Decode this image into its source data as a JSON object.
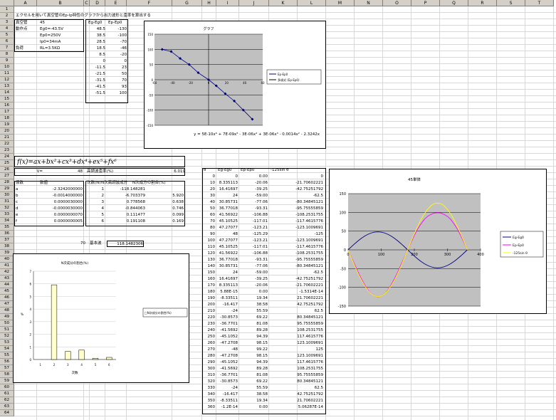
{
  "title_row": "エクセルを用いて真空管のEp-Ip特性のグラフから出力波形と歪率を算出する",
  "columns": [
    "A",
    "B",
    "C",
    "D",
    "E",
    "F",
    "G",
    "H",
    "I",
    "J",
    "K",
    "L",
    "M",
    "N",
    "O",
    "P",
    "Q",
    "R",
    "S",
    "T"
  ],
  "params": [
    {
      "label": "真空管",
      "value": "45"
    },
    {
      "label": "動作点",
      "value": "Eg0=-43.5V"
    },
    {
      "label": "",
      "value": "Ep0=250V"
    },
    {
      "label": "",
      "value": "Ip0=34mA"
    },
    {
      "label": "負荷",
      "value": "RL=3.5KΩ"
    }
  ],
  "egep": {
    "headers": [
      "Eg-Eg0",
      "Ep-Ep0"
    ],
    "rows": [
      [
        "48.5",
        "-130"
      ],
      [
        "38.5",
        "-100"
      ],
      [
        "28.5",
        "-70"
      ],
      [
        "18.5",
        "-46"
      ],
      [
        "8.5",
        "-20"
      ],
      [
        "0",
        "0"
      ],
      [
        "-11.5",
        "23"
      ],
      [
        "-21.5",
        "50"
      ],
      [
        "-31.5",
        "70"
      ],
      [
        "-41.5",
        "93"
      ],
      [
        "-51.5",
        "100"
      ]
    ]
  },
  "formula": "f(x)=ax+bx²+cx³+dx⁴+ex⁵+fx⁶",
  "v_label": "V=",
  "v_value": "48",
  "distortion_label": "高調波歪率(%)",
  "distortion_value": "6.019",
  "coef": {
    "headers": [
      "係数",
      "数値"
    ],
    "rows": [
      [
        "a",
        "-2.3242000000"
      ],
      [
        "b",
        "-0.0014000000"
      ],
      [
        "c",
        "0.0000030000"
      ],
      [
        "d",
        "-0.0000030000"
      ],
      [
        "e",
        "0.0000000070"
      ],
      [
        "f",
        "0.0000000005"
      ]
    ]
  },
  "harm": {
    "headers": [
      "次数(N)",
      "N次高調波成分",
      "N次成分の割合(%)"
    ],
    "rows": [
      [
        "1",
        "-118.148281",
        ""
      ],
      [
        "2",
        "-6.703379",
        "5.920"
      ],
      [
        "3",
        "0.778568",
        "0.638"
      ],
      [
        "4",
        "-0.844063",
        "0.746"
      ],
      [
        "5",
        "0.111477",
        "0.099"
      ],
      [
        "6",
        "0.191108",
        "0.169"
      ]
    ]
  },
  "fund": {
    "label": "70",
    "name": "基本波",
    "value": "118.1482306"
  },
  "table": {
    "headers": [
      "θ",
      "Eg-Eg0",
      "Ep-Ep0",
      "-125sin θ"
    ],
    "rows": [
      [
        "0",
        "0",
        "0.00",
        "0"
      ],
      [
        "10",
        "8.335113",
        "-20.06",
        "-21.70602221"
      ],
      [
        "20",
        "16.41697",
        "-39.25",
        "-42.75251792"
      ],
      [
        "30",
        "24",
        "-59.00",
        "-62.5"
      ],
      [
        "40",
        "30.85731",
        "-77.06",
        "-80.34845121"
      ],
      [
        "50",
        "36.77018",
        "-93.31",
        "-95.75555859"
      ],
      [
        "60",
        "41.56922",
        "-106.88",
        "-108.2531755"
      ],
      [
        "70",
        "45.10525",
        "-117.01",
        "-117.4615776"
      ],
      [
        "80",
        "47.27077",
        "-123.21",
        "-123.1009691"
      ],
      [
        "90",
        "48",
        "-125.29",
        "-125"
      ],
      [
        "100",
        "47.27077",
        "-123.21",
        "-123.1009691"
      ],
      [
        "110",
        "45.10525",
        "-117.01",
        "-117.4615776"
      ],
      [
        "120",
        "41.56922",
        "-106.88",
        "-108.2531755"
      ],
      [
        "130",
        "36.77018",
        "-93.31",
        "-95.75555859"
      ],
      [
        "140",
        "30.85731",
        "-77.06",
        "-80.34845121"
      ],
      [
        "150",
        "24",
        "-59.00",
        "-62.5"
      ],
      [
        "160",
        "16.41697",
        "-39.25",
        "-42.75251792"
      ],
      [
        "170",
        "8.335113",
        "-20.06",
        "-21.70602221"
      ],
      [
        "180",
        "5.88E-15",
        "0.00",
        "-1.5314E-14"
      ],
      [
        "190",
        "-8.33511",
        "19.34",
        "21.70602221"
      ],
      [
        "200",
        "-16.417",
        "38.58",
        "42.75251792"
      ],
      [
        "210",
        "-24",
        "55.59",
        "62.5"
      ],
      [
        "220",
        "-30.8573",
        "69.22",
        "80.34845121"
      ],
      [
        "230",
        "-36.7701",
        "81.08",
        "95.75555859"
      ],
      [
        "240",
        "-41.5692",
        "89.28",
        "108.2531755"
      ],
      [
        "250",
        "-45.1052",
        "94.39",
        "117.4615776"
      ],
      [
        "260",
        "-47.2708",
        "98.15",
        "123.1009691"
      ],
      [
        "270",
        "-48",
        "99.22",
        "125"
      ],
      [
        "280",
        "-47.2708",
        "98.15",
        "123.1009691"
      ],
      [
        "290",
        "-45.1052",
        "94.39",
        "117.4615776"
      ],
      [
        "300",
        "-41.5692",
        "89.28",
        "108.2531755"
      ],
      [
        "310",
        "-36.7701",
        "81.08",
        "95.75555859"
      ],
      [
        "320",
        "-30.8573",
        "69.22",
        "80.34845121"
      ],
      [
        "330",
        "-24",
        "55.59",
        "62.5"
      ],
      [
        "340",
        "-16.417",
        "38.58",
        "42.75251792"
      ],
      [
        "350",
        "-8.33511",
        "19.34",
        "21.70602221"
      ],
      [
        "360",
        "-1.2E-14",
        "0.00",
        "5.06287E-14"
      ]
    ]
  },
  "chart_data": [
    {
      "type": "scatter",
      "title": "グラフ",
      "series": [
        {
          "name": "Ep-Ep0",
          "x": [
            48.5,
            38.5,
            28.5,
            18.5,
            8.5,
            0,
            -11.5,
            -21.5,
            -31.5,
            -41.5,
            -51.5
          ],
          "y": [
            -130,
            -100,
            -70,
            -46,
            -20,
            0,
            23,
            50,
            70,
            93,
            100
          ]
        }
      ],
      "trend_legend": "多項式 (Ep-Ep0)",
      "trend_equation": "y = 5E-10x⁶ + 7E-09x⁵ - 3E-06x⁴ + 3E-06x³ - 0.0014x² - 2.3242x",
      "xlim": [
        -60,
        60
      ],
      "ylim": [
        -150,
        150
      ],
      "xticks": [
        -60,
        -40,
        -20,
        0,
        20,
        40,
        60
      ],
      "yticks": [
        -150,
        -100,
        -50,
        0,
        50,
        100,
        150
      ],
      "colors": {
        "series": "#000080",
        "plot_bg": "#c0c0c0"
      }
    },
    {
      "type": "bar",
      "title": "N次成分の割合(%)",
      "legend": "□N次成分の割合(%)",
      "categories": [
        "1",
        "2",
        "3",
        "4",
        "5",
        "6"
      ],
      "values": [
        0,
        5.92,
        0.638,
        0.746,
        0.099,
        0.169
      ],
      "xlabel": "次数",
      "ylabel": "%",
      "ylim": [
        0,
        7
      ],
      "yticks": [
        0,
        1,
        2,
        3,
        4,
        5,
        6,
        7
      ],
      "colors": {
        "bar": "#ffffcc"
      }
    },
    {
      "type": "line",
      "title": "45単体",
      "x": [
        0,
        10,
        20,
        30,
        40,
        50,
        60,
        70,
        80,
        90,
        100,
        110,
        120,
        130,
        140,
        150,
        160,
        170,
        180,
        190,
        200,
        210,
        220,
        230,
        240,
        250,
        260,
        270,
        280,
        290,
        300,
        310,
        320,
        330,
        340,
        350,
        360
      ],
      "series": [
        {
          "name": "Eg-Eg0",
          "values": [
            0,
            8.34,
            16.42,
            24,
            30.86,
            36.77,
            41.57,
            45.11,
            47.27,
            48,
            47.27,
            45.11,
            41.57,
            36.77,
            30.86,
            24,
            16.42,
            8.34,
            0,
            -8.34,
            -16.42,
            -24,
            -30.86,
            -36.77,
            -41.57,
            -45.11,
            -47.27,
            -48,
            -47.27,
            -45.11,
            -41.57,
            -36.77,
            -30.86,
            -24,
            -16.42,
            -8.34,
            0
          ]
        },
        {
          "name": "Ep-Ep0",
          "values": [
            0,
            -20.06,
            -39.25,
            -59,
            -77.06,
            -93.31,
            -106.88,
            -117.01,
            -123.21,
            -125.29,
            -123.21,
            -117.01,
            -106.88,
            -93.31,
            -77.06,
            -59,
            -39.25,
            -20.06,
            0,
            19.34,
            38.58,
            55.59,
            69.22,
            81.08,
            89.28,
            94.39,
            98.15,
            99.22,
            98.15,
            94.39,
            89.28,
            81.08,
            69.22,
            55.59,
            38.58,
            19.34,
            0
          ]
        },
        {
          "name": "-125sin θ",
          "values": [
            0,
            -21.71,
            -42.75,
            -62.5,
            -80.35,
            -95.76,
            -108.25,
            -117.46,
            -123.1,
            -125,
            -123.1,
            -117.46,
            -108.25,
            -95.76,
            -80.35,
            -62.5,
            -42.75,
            -21.71,
            0,
            21.71,
            42.75,
            62.5,
            80.35,
            95.76,
            108.25,
            117.46,
            123.1,
            125,
            123.1,
            117.46,
            108.25,
            95.76,
            80.35,
            62.5,
            42.75,
            21.71,
            0
          ]
        }
      ],
      "xlim": [
        0,
        400
      ],
      "ylim": [
        -150,
        150
      ],
      "xticks": [
        0,
        100,
        200,
        300,
        400
      ],
      "yticks": [
        -150,
        -100,
        -50,
        0,
        50,
        100,
        150
      ],
      "colors": {
        "Eg-Eg0": "#000080",
        "Ep-Ep0": "#ff00ff",
        "-125sin θ": "#ffff00",
        "plot_bg": "#c0c0c0"
      }
    }
  ]
}
